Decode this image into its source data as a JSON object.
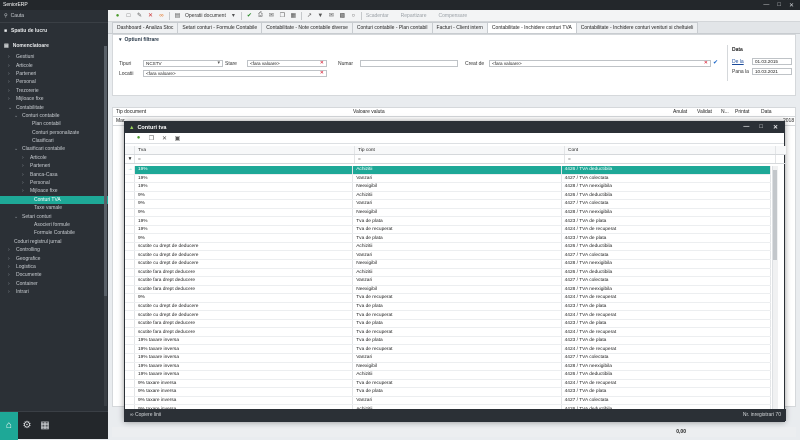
{
  "app": {
    "title": "SeniorERP",
    "search_placeholder": "Cauta"
  },
  "sidebar": {
    "top": [
      {
        "label": "Spatiu de lucru"
      },
      {
        "label": "Nomenclatoare"
      }
    ],
    "items": [
      {
        "label": "Gestiuni",
        "level": "head"
      },
      {
        "label": "Articole",
        "level": "head"
      },
      {
        "label": "Parteneri",
        "level": "head"
      },
      {
        "label": "Personal",
        "level": "head"
      },
      {
        "label": "Trezorerie",
        "level": "head"
      },
      {
        "label": "Mijloace fixe",
        "level": "head"
      },
      {
        "label": "Contabilitate",
        "level": "head-open"
      },
      {
        "label": "Conturi contabile",
        "level": "l1-open"
      },
      {
        "label": "Plan contabil",
        "level": "leaf1"
      },
      {
        "label": "Conturi personalizate",
        "level": "leaf1"
      },
      {
        "label": "Clasificari",
        "level": "leaf1"
      },
      {
        "label": "Clasificari contabile",
        "level": "l1-open"
      },
      {
        "label": "Articole",
        "level": "l2"
      },
      {
        "label": "Parteneri",
        "level": "l2"
      },
      {
        "label": "Banca-Casa",
        "level": "l2"
      },
      {
        "label": "Personal",
        "level": "l2"
      },
      {
        "label": "Mijloace fixe",
        "level": "l2"
      },
      {
        "label": "Conturi TVA",
        "level": "leaf2-active"
      },
      {
        "label": "Taxe vamale",
        "level": "leaf2"
      },
      {
        "label": "Setari conturi",
        "level": "l1-open"
      },
      {
        "label": "Asocieri formule",
        "level": "leaf2"
      },
      {
        "label": "Formule Contabile",
        "level": "leaf2"
      },
      {
        "label": "Coduri registrul jurnal",
        "level": "l1"
      },
      {
        "label": "Controlling",
        "level": "head"
      },
      {
        "label": "Geografice",
        "level": "head"
      },
      {
        "label": "Logistica",
        "level": "head"
      },
      {
        "label": "Documente",
        "level": "head"
      },
      {
        "label": "Container",
        "level": "head"
      },
      {
        "label": "Intrari",
        "level": "head"
      }
    ]
  },
  "toolbar": {
    "operatii": "Operatii document",
    "scadentar": "Scadentar",
    "repartizare": "Repartizare",
    "compensare": "Compensare"
  },
  "tabs": [
    {
      "label": "Dashboard - Analiza Stoc"
    },
    {
      "label": "Setari conturi - Formule Contabile"
    },
    {
      "label": "Contabilitate - Note contabile diverse"
    },
    {
      "label": "Conturi contabile - Plan contabil"
    },
    {
      "label": "Facturi - Client intern"
    },
    {
      "label": "Contabilitate - Inchidere conturi TVA"
    },
    {
      "label": "Contabilitate - Inchidere conturi venituri si cheltuieli"
    }
  ],
  "filter": {
    "title": "Optiuni filtrare",
    "tipuri_label": "Tipuri",
    "tipuri_value": "NCSTV",
    "stare_label": "Stare",
    "stare_value": "<fara valoare>",
    "locatii_label": "Locatii",
    "locatii_value": "<fara valoare>",
    "numar_label": "Numar",
    "creat_label": "Creat de",
    "creat_value": "<fara valoare>",
    "data_title": "Data",
    "de_la_label": "De la",
    "de_la_value": "01.03.2015",
    "pana_la_label": "Pana la",
    "pana_la_value": "10.03.2021"
  },
  "bg_grid": {
    "col_tip": "Tip document",
    "col_valoare": "Valoare valuta",
    "col_anulat": "Anulat",
    "col_validat": "Validat",
    "col_n": "N...",
    "col_printat": "Printat",
    "col_data": "Data",
    "row_stub": "Mar",
    "year_stub": "2018",
    "total": "0,00"
  },
  "dialog": {
    "title": "Conturi tva",
    "col_tva": "Tva",
    "col_tip": "Tip cont",
    "col_cont": "Cont",
    "filter_mark": "=",
    "footer_left": "Copiere linii",
    "footer_right": "Nr. inregistrari 70",
    "rows": [
      {
        "tva": "19%",
        "tip": "Achizitii",
        "cont": "4426  /  TVA deductibila",
        "sel": true
      },
      {
        "tva": "19%",
        "tip": "Vanzari",
        "cont": "4427  /  TVA colectata"
      },
      {
        "tva": "19%",
        "tip": "Neexigibil",
        "cont": "4428  /  TVA neexigibila"
      },
      {
        "tva": "9%",
        "tip": "Achizitii",
        "cont": "4426  /  TVA deductibila"
      },
      {
        "tva": "9%",
        "tip": "Vanzari",
        "cont": "4427  /  TVA colectata"
      },
      {
        "tva": "9%",
        "tip": "Neexigibil",
        "cont": "4428  /  TVA neexigibila"
      },
      {
        "tva": "19%",
        "tip": "Tva de plata",
        "cont": "4423  /  TVA de plata"
      },
      {
        "tva": "19%",
        "tip": "Tva de recuperat",
        "cont": "4424  /  TVA de recuperat"
      },
      {
        "tva": "9%",
        "tip": "Tva de plata",
        "cont": "4423  /  TVA de plata"
      },
      {
        "tva": "scutite cu drept de deducere",
        "tip": "Achizitii",
        "cont": "4426  /  TVA deductibila"
      },
      {
        "tva": "scutite cu drept de deducere",
        "tip": "Vanzari",
        "cont": "4427  /  TVA colectata"
      },
      {
        "tva": "scutite cu drept de deducere",
        "tip": "Neexigibil",
        "cont": "4428  /  TVA neexigibila"
      },
      {
        "tva": "scutite fara drept deducere",
        "tip": "Achizitii",
        "cont": "4426  /  TVA deductibila"
      },
      {
        "tva": "scutite fara drept deducere",
        "tip": "Vanzari",
        "cont": "4427  /  TVA colectata"
      },
      {
        "tva": "scutite fara drept deducere",
        "tip": "Neexigibil",
        "cont": "4428  /  TVA neexigibila"
      },
      {
        "tva": "9%",
        "tip": "Tva de recuperat",
        "cont": "4424  /  TVA de recuperat"
      },
      {
        "tva": "scutite cu drept de deducere",
        "tip": "Tva de plata",
        "cont": "4423  /  TVA de plata"
      },
      {
        "tva": "scutite cu drept de deducere",
        "tip": "Tva de recuperat",
        "cont": "4424  /  TVA de recuperat"
      },
      {
        "tva": "scutite fara drept deducere",
        "tip": "Tva de plata",
        "cont": "4423  /  TVA de plata"
      },
      {
        "tva": "scutite fara drept deducere",
        "tip": "Tva de recuperat",
        "cont": "4424  /  TVA de recuperat"
      },
      {
        "tva": "19% taxare inversa",
        "tip": "Tva de plata",
        "cont": "4423  /  TVA de plata"
      },
      {
        "tva": "19% taxare inversa",
        "tip": "Tva de recuperat",
        "cont": "4424  /  TVA de recuperat"
      },
      {
        "tva": "19% taxare inversa",
        "tip": "Vanzari",
        "cont": "4427  /  TVA colectata"
      },
      {
        "tva": "19% taxare inversa",
        "tip": "Neexigibil",
        "cont": "4428  /  TVA neexigibila"
      },
      {
        "tva": "19% taxare inversa",
        "tip": "Achizitii",
        "cont": "4426  /  TVA deductibila"
      },
      {
        "tva": "9% taxare inversa",
        "tip": "Tva de recuperat",
        "cont": "4424  /  TVA de recuperat"
      },
      {
        "tva": "9% taxare inversa",
        "tip": "Tva de plata",
        "cont": "4423  /  TVA de plata"
      },
      {
        "tva": "9% taxare inversa",
        "tip": "Vanzari",
        "cont": "4427  /  TVA colectata"
      },
      {
        "tva": "9% taxare inversa",
        "tip": "Achizitii",
        "cont": "4426  /  TVA deductibila"
      }
    ]
  }
}
